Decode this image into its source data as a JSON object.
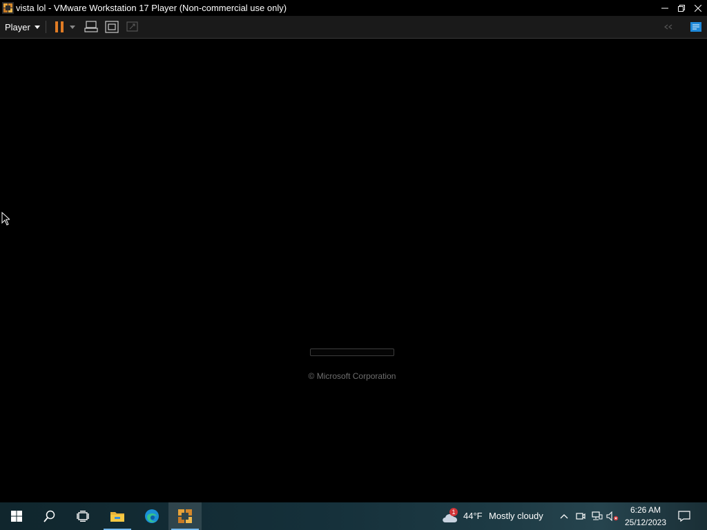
{
  "window": {
    "title": "vista lol - VMware Workstation 17 Player (Non-commercial use only)",
    "controls": [
      "minimize",
      "restore",
      "close"
    ]
  },
  "toolbar": {
    "player_menu_label": "Player",
    "buttons": [
      "pause-icon",
      "send-ctrl-alt-del-icon",
      "fullscreen-icon",
      "unity-icon"
    ]
  },
  "vm": {
    "copyright": "© Microsoft Corporation",
    "progress_fraction": 0.0
  },
  "taskbar": {
    "weather": {
      "badge": "1",
      "temperature": "44°F",
      "description": "Mostly cloudy"
    },
    "clock": {
      "time": "6:26 AM",
      "date": "25/12/2023"
    }
  },
  "colors": {
    "accent_orange": "#e07b24",
    "taskbar_highlight": "#76b9ed",
    "background": "#000000"
  }
}
